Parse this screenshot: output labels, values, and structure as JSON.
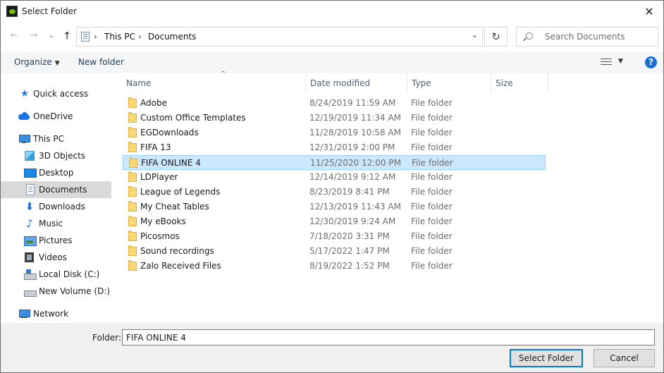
{
  "window": {
    "title": "Select Folder",
    "close_glyph": "✕"
  },
  "address": {
    "crumbs": [
      "This PC",
      "Documents"
    ],
    "sep": "›",
    "dropdown": "⌄",
    "refresh": "↻"
  },
  "nav_buttons": {
    "back": "←",
    "forward": "→",
    "history": "⌄",
    "up": "↑"
  },
  "search": {
    "placeholder": "Search Documents"
  },
  "toolbar": {
    "organize": "Organize",
    "organize_caret": "▼",
    "new_folder": "New folder",
    "view_caret": "▼",
    "help": "?"
  },
  "sidebar": {
    "items": [
      {
        "label": "Quick access",
        "icon": "star-icon"
      },
      {
        "label": "OneDrive",
        "icon": "cloud-icon"
      },
      {
        "label": "This PC",
        "icon": "computer-icon"
      },
      {
        "label": "3D Objects",
        "icon": "cube-icon"
      },
      {
        "label": "Desktop",
        "icon": "desktop-icon"
      },
      {
        "label": "Documents",
        "icon": "document-icon",
        "selected": true
      },
      {
        "label": "Downloads",
        "icon": "download-icon"
      },
      {
        "label": "Music",
        "icon": "music-icon"
      },
      {
        "label": "Pictures",
        "icon": "pictures-icon"
      },
      {
        "label": "Videos",
        "icon": "videos-icon"
      },
      {
        "label": "Local Disk (C:)",
        "icon": "drive-icon"
      },
      {
        "label": "New Volume (D:)",
        "icon": "drive-icon"
      },
      {
        "label": "Network",
        "icon": "network-icon"
      }
    ]
  },
  "columns": {
    "name": "Name",
    "date": "Date modified",
    "type": "Type",
    "size": "Size",
    "sort_glyph": "^"
  },
  "files": [
    {
      "name": "Adobe",
      "date": "8/24/2019 11:59 AM",
      "type": "File folder"
    },
    {
      "name": "Custom Office Templates",
      "date": "12/19/2019 11:34 AM",
      "type": "File folder"
    },
    {
      "name": "EGDownloads",
      "date": "11/28/2019 10:58 AM",
      "type": "File folder"
    },
    {
      "name": "FIFA 13",
      "date": "12/31/2019 2:00 PM",
      "type": "File folder"
    },
    {
      "name": "FIFA ONLINE 4",
      "date": "11/25/2020 12:00 PM",
      "type": "File folder",
      "selected": true
    },
    {
      "name": "LDPlayer",
      "date": "12/14/2019 9:12 AM",
      "type": "File folder"
    },
    {
      "name": "League of Legends",
      "date": "8/23/2019 8:41 PM",
      "type": "File folder"
    },
    {
      "name": "My Cheat Tables",
      "date": "12/13/2019 11:43 AM",
      "type": "File folder"
    },
    {
      "name": "My eBooks",
      "date": "12/30/2019 9:24 AM",
      "type": "File folder"
    },
    {
      "name": "Picosmos",
      "date": "7/18/2020 3:31 PM",
      "type": "File folder"
    },
    {
      "name": "Sound recordings",
      "date": "5/17/2022 1:47 PM",
      "type": "File folder"
    },
    {
      "name": "Zalo Received Files",
      "date": "8/19/2022 1:52 PM",
      "type": "File folder"
    }
  ],
  "footer": {
    "folder_label": "Folder:",
    "folder_value": "FIFA ONLINE 4",
    "select_button": "Select Folder",
    "cancel_button": "Cancel"
  },
  "colors": {
    "selection_bg": "#cce8ff",
    "selection_border": "#99d1ff",
    "accent": "#0078d7",
    "folder": "#f8d775"
  }
}
